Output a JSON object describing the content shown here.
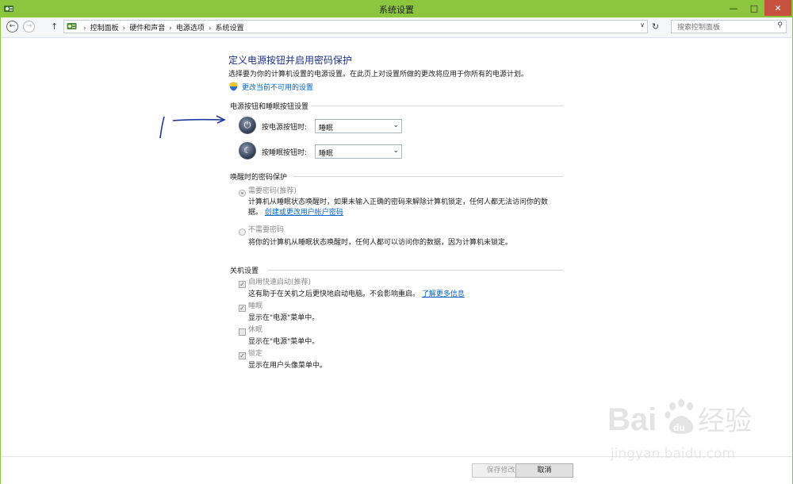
{
  "window": {
    "title": "系统设置",
    "min_symbol": "—",
    "max_symbol": "□",
    "close_symbol": "✕"
  },
  "nav": {
    "back_symbol": "←",
    "forward_symbol": "→",
    "up_symbol": "↑",
    "breadcrumbs": [
      "控制面板",
      "硬件和声音",
      "电源选项",
      "系统设置"
    ],
    "sep": "›",
    "dropdown_symbol": "∨",
    "refresh_symbol": "↻",
    "search_placeholder": "搜索控制面板",
    "search_icon": "⚲"
  },
  "main": {
    "heading": "定义电源按钮并启用密码保护",
    "description": "选择要为你的计算机设置的电源设置。在此页上对设置所做的更改将应用于你所有的电源计划。",
    "change_link": "更改当前不可用的设置"
  },
  "buttons_section": {
    "title": "电源按钮和睡眠按钮设置",
    "power_label": "按电源按钮时:",
    "power_value": "睡眠",
    "sleep_label": "按睡眠按钮时:",
    "sleep_value": "睡眠",
    "dropdown_symbol": "⌄"
  },
  "password_section": {
    "title": "唤醒时的密码保护",
    "require_label": "需要密码(推荐)",
    "require_desc_1": "计算机从睡眠状态唤醒时，如果未输入正确的密码来解除计算机锁定，任何人都无法访问你的数",
    "require_desc_2": "据。",
    "require_link": "创建或更改用户帐户密码",
    "norequire_label": "不需要密码",
    "norequire_desc": "将你的计算机从睡眠状态唤醒时，任何人都可以访问你的数据，因为计算机未锁定。"
  },
  "shutdown_section": {
    "title": "关机设置",
    "check_symbol": "✓",
    "items": [
      {
        "label": "启用快速启动(推荐)",
        "desc": "这有助于在关机之后更快地启动电脑。不会影响重启。",
        "link": "了解更多信息",
        "checked": true
      },
      {
        "label": "睡眠",
        "desc": "显示在\"电源\"菜单中。",
        "checked": true
      },
      {
        "label": "休眠",
        "desc": "显示在\"电源\"菜单中。",
        "checked": false
      },
      {
        "label": "锁定",
        "desc": "显示在用户头像菜单中。",
        "checked": true
      }
    ]
  },
  "footer": {
    "save_label": "保存修改",
    "cancel_label": "取消"
  },
  "watermark": {
    "logo": "Bai du 经验",
    "url": "jingyan.baidu.com"
  },
  "colors": {
    "titlebar": "#8cc63f",
    "link": "#0066cc",
    "heading": "#1e3287",
    "close": "#c7503e"
  }
}
